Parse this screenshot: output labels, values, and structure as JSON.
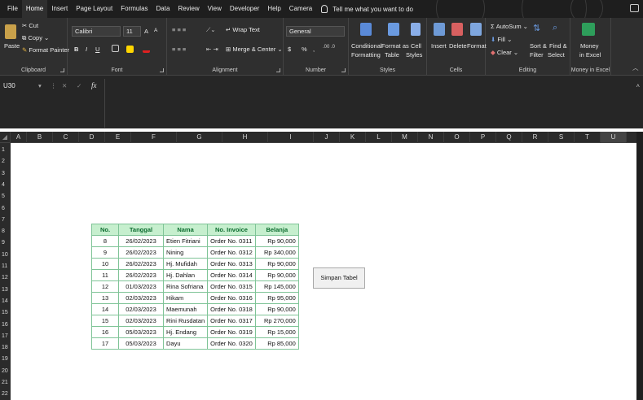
{
  "menu": {
    "tabs": [
      "File",
      "Home",
      "Insert",
      "Page Layout",
      "Formulas",
      "Data",
      "Review",
      "View",
      "Developer",
      "Help",
      "Camera"
    ],
    "active": "Home",
    "tell_me": "Tell me what you want to do"
  },
  "ribbon": {
    "clipboard": {
      "paste": "Paste",
      "cut": "Cut",
      "copy": "Copy",
      "format_painter": "Format Painter",
      "label": "Clipboard"
    },
    "font": {
      "name": "Calibri",
      "size": "11",
      "grow": "A",
      "shrink": "A",
      "bold": "B",
      "italic": "I",
      "underline": "U",
      "label": "Font"
    },
    "alignment": {
      "wrap_text": "Wrap Text",
      "merge_center": "Merge & Center",
      "label": "Alignment"
    },
    "number": {
      "format": "General",
      "currency": "$",
      "percent": "%",
      "comma": ",",
      "label": "Number"
    },
    "styles": {
      "conditional": "Conditional",
      "formatting": "Formatting",
      "format_as": "Format as",
      "table": "Table",
      "cell": "Cell",
      "cell_styles": "Styles",
      "label": "Styles"
    },
    "cells": {
      "insert": "Insert",
      "delete": "Delete",
      "format": "Format",
      "label": "Cells"
    },
    "editing": {
      "autosum": "AutoSum",
      "fill": "Fill",
      "clear": "Clear",
      "sort": "Sort &",
      "filter": "Filter",
      "find": "Find &",
      "select": "Select",
      "label": "Editing"
    },
    "money": {
      "money": "Money",
      "in_excel": "in Excel",
      "label": "Money in Excel"
    }
  },
  "formula_bar": {
    "name_box": "U30",
    "fx": "fx",
    "cancel": "✕",
    "enter": "✓"
  },
  "columns": [
    "A",
    "B",
    "C",
    "D",
    "E",
    "F",
    "G",
    "H",
    "I",
    "J",
    "K",
    "L",
    "M",
    "N",
    "O",
    "P",
    "Q",
    "R",
    "S",
    "T",
    "U"
  ],
  "rows": [
    "1",
    "2",
    "3",
    "4",
    "5",
    "6",
    "7",
    "8",
    "9",
    "10",
    "11",
    "12",
    "13",
    "14",
    "15",
    "16",
    "17",
    "18",
    "19",
    "20",
    "21",
    "22"
  ],
  "table": {
    "headers": [
      "No.",
      "Tanggal",
      "Nama",
      "No. Invoice",
      "Belanja"
    ],
    "rows": [
      [
        "8",
        "26/02/2023",
        "Etien Fitriani",
        "Order No. 0311",
        "Rp 90,000"
      ],
      [
        "9",
        "26/02/2023",
        "Nining",
        "Order No. 0312",
        "Rp 340,000"
      ],
      [
        "10",
        "26/02/2023",
        "Hj. Mufidah",
        "Order No. 0313",
        "Rp 90,000"
      ],
      [
        "11",
        "26/02/2023",
        "Hj. Dahlan",
        "Order No. 0314",
        "Rp 90,000"
      ],
      [
        "12",
        "01/03/2023",
        "Rina Sofriana",
        "Order No. 0315",
        "Rp 145,000"
      ],
      [
        "13",
        "02/03/2023",
        "Hikam",
        "Order No. 0316",
        "Rp 95,000"
      ],
      [
        "14",
        "02/03/2023",
        "Maemunah",
        "Order No. 0318",
        "Rp 90,000"
      ],
      [
        "15",
        "02/03/2023",
        "Rini Rusdatan",
        "Order No. 0317",
        "Rp 270,000"
      ],
      [
        "16",
        "05/03/2023",
        "Hj. Endang",
        "Order No. 0319",
        "Rp 15,000"
      ],
      [
        "17",
        "05/03/2023",
        "Dayu",
        "Order No. 0320",
        "Rp 85,000"
      ]
    ]
  },
  "button": {
    "simpan": "Simpan Tabel"
  },
  "colors": {
    "header_fill": "#c6efce",
    "header_text": "#0b6b2e",
    "border": "#7fc497",
    "ribbon_bg": "#2f2f2f"
  }
}
